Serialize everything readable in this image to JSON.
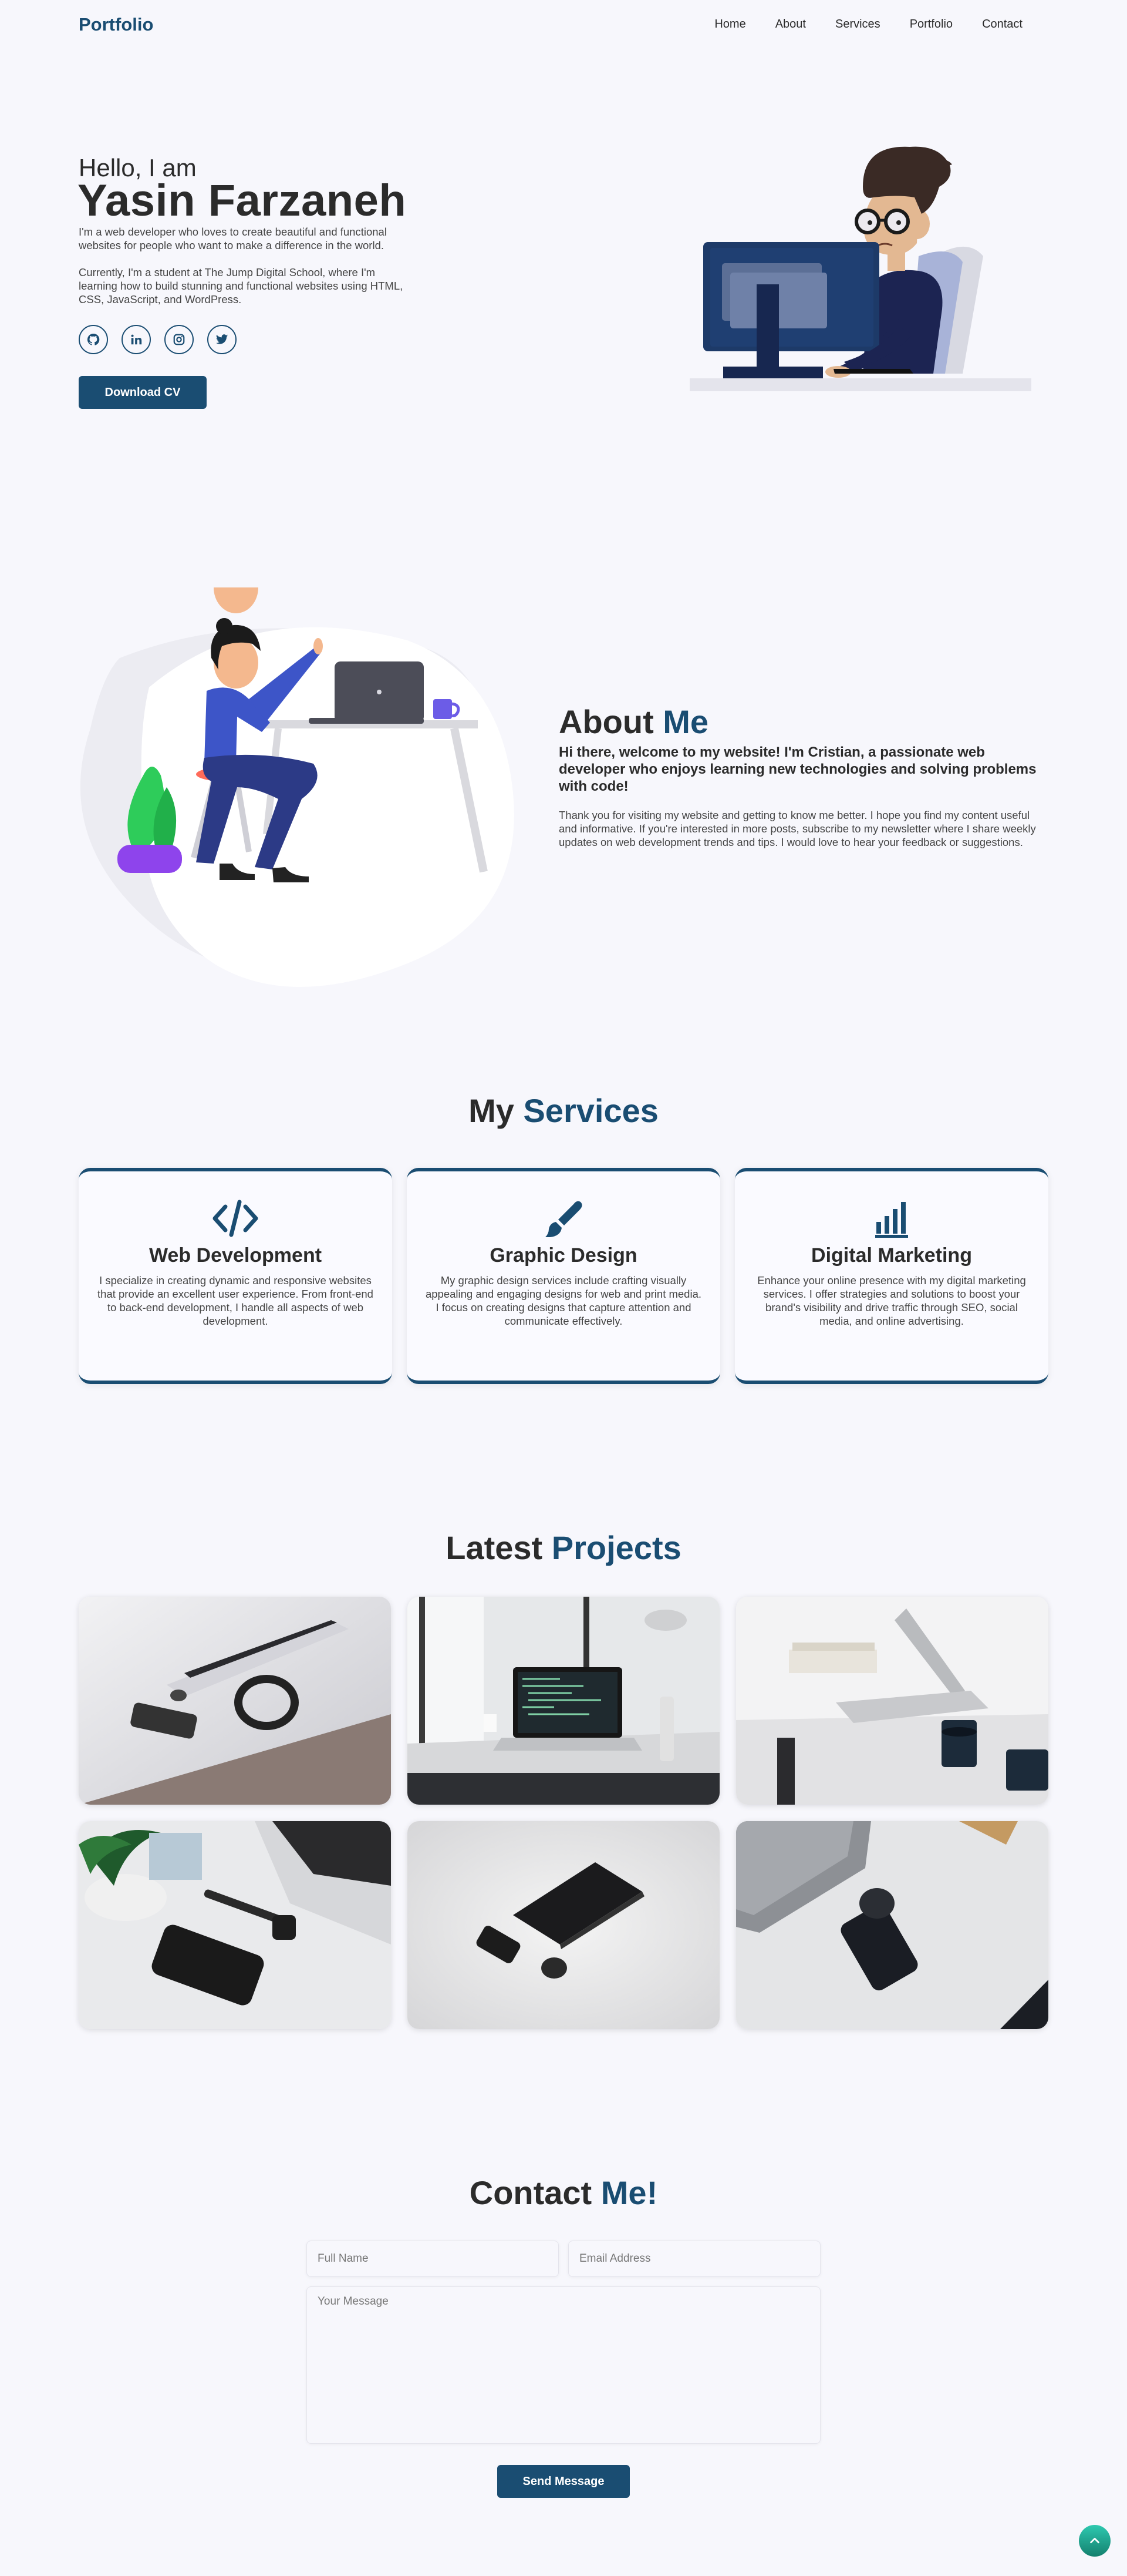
{
  "nav": {
    "logo": "Portfolio",
    "links": [
      "Home",
      "About",
      "Services",
      "Portfolio",
      "Contact"
    ]
  },
  "hero": {
    "greeting": "Hello, I am",
    "name": "Yasin Farzaneh",
    "intro": "I'm a web developer who loves to create beautiful and functional websites for people who want to make a difference in the world.",
    "school": "Currently, I'm a student at The Jump Digital School, where I'm learning how to build stunning and functional websites using HTML, CSS, JavaScript, and WordPress.",
    "socials": [
      "github-icon",
      "linkedin-icon",
      "instagram-icon",
      "twitter-icon"
    ],
    "cv_button": "Download CV"
  },
  "about": {
    "title_a": "About",
    "title_b": "Me",
    "lead": "Hi there, welcome to my website! I'm Cristian, a passionate web developer who enjoys learning new technologies and solving problems with code!",
    "body": "Thank you for visiting my website and getting to know me better. I hope you find my content useful and informative. If you're interested in more posts, subscribe to my newsletter where I share weekly updates on web development trends and tips. I would love to hear your feedback or suggestions."
  },
  "services": {
    "title_a": "My",
    "title_b": "Services",
    "items": [
      {
        "icon": "code-icon",
        "title": "Web Development",
        "text": "I specialize in creating dynamic and responsive websites that provide an excellent user experience. From front-end to back-end development, I handle all aspects of web development."
      },
      {
        "icon": "brush-icon",
        "title": "Graphic Design",
        "text": "My graphic design services include crafting visually appealing and engaging designs for web and print media. I focus on creating designs that capture attention and communicate effectively."
      },
      {
        "icon": "bar-chart-icon",
        "title": "Digital Marketing",
        "text": "Enhance your online presence with my digital marketing services. I offer strategies and solutions to boost your brand's visibility and drive traffic through SEO, social media, and online advertising."
      }
    ]
  },
  "projects": {
    "title_a": "Latest",
    "title_b": "Projects"
  },
  "contact": {
    "title_a": "Contact",
    "title_b": "Me!",
    "name_placeholder": "Full Name",
    "email_placeholder": "Email Address",
    "message_placeholder": "Your Message",
    "send_button": "Send Message"
  },
  "colors": {
    "accent": "#1a4d72",
    "background": "#f7f7fc",
    "to_top": "#1fa890"
  }
}
